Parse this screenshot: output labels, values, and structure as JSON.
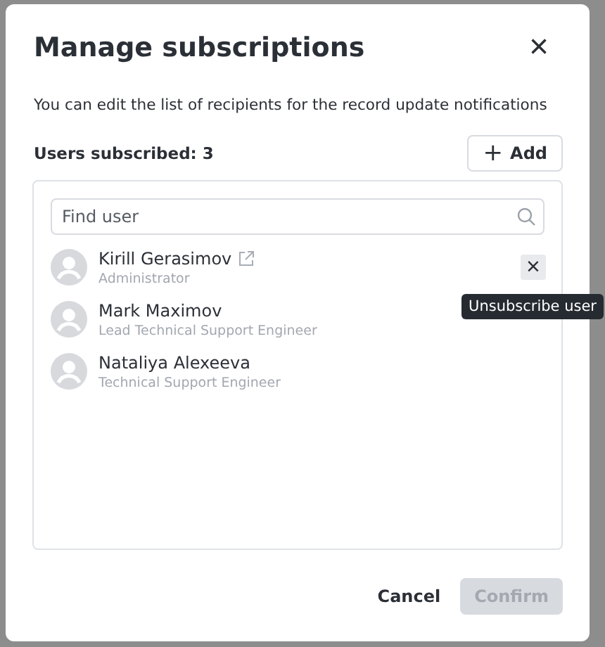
{
  "dialog": {
    "title": "Manage subscriptions",
    "close": "×",
    "description": "You can edit the list of recipients for the record update notifications",
    "subscribed_label": "Users subscribed: 3",
    "add_button": {
      "icon": "+",
      "label": "Add"
    },
    "search": {
      "placeholder": "Find user"
    },
    "users": [
      {
        "name": "Kirill Gerasimov",
        "role": "Administrator",
        "link": true,
        "hovered": true
      },
      {
        "name": "Mark Maximov",
        "role": "Lead Technical Support Engineer",
        "link": false,
        "hovered": false
      },
      {
        "name": "Nataliya Alexeeva",
        "role": "Technical Support Engineer",
        "link": false,
        "hovered": false
      }
    ],
    "remove_icon": "×",
    "tooltip": "Unsubscribe user",
    "buttons": [
      {
        "label": "Cancel",
        "kind": "text",
        "disabled": false
      },
      {
        "label": "Confirm",
        "kind": "primary",
        "disabled": true
      }
    ]
  }
}
